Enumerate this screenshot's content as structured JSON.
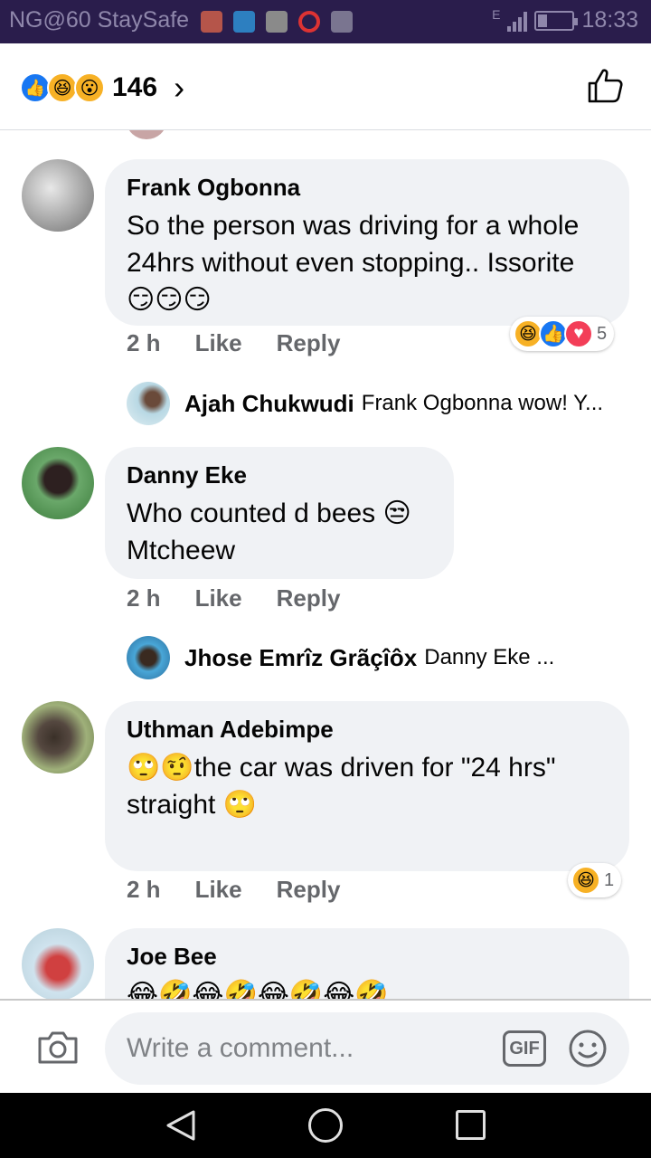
{
  "status_bar": {
    "carrier": "NG@60 StaySafe",
    "time": "18:33",
    "network": "E"
  },
  "header": {
    "reaction_icons": [
      "like-icon",
      "haha-icon",
      "wow-icon"
    ],
    "reaction_count": "146",
    "chevron": "›"
  },
  "comments": [
    {
      "name": "Frank Ogbonna",
      "text": "So the person was driving for a whole 24hrs without even stopping.. Issorite 😏😏😏",
      "time": "2 h",
      "like": "Like",
      "reply": "Reply",
      "reactions": [
        "haha-icon",
        "like-icon",
        "love-icon"
      ],
      "reaction_count": "5",
      "reply_preview": {
        "name": "Ajah Chukwudi",
        "text": "Frank Ogbonna wow! Y..."
      }
    },
    {
      "name": "Danny Eke",
      "text": "Who counted d bees 😒 Mtcheew",
      "time": "2 h",
      "like": "Like",
      "reply": "Reply",
      "reply_preview": {
        "name": "Jhose Emrîz Grãçîôx",
        "text": "Danny Eke ..."
      }
    },
    {
      "name": "Uthman Adebimpe",
      "text": "🙄🤨the car was driven for \"24 hrs\" straight 🙄",
      "time": "2 h",
      "like": "Like",
      "reply": "Reply",
      "reactions": [
        "haha-icon"
      ],
      "reaction_count": "1"
    },
    {
      "name": "Joe Bee",
      "text": "😂🤣😂🤣😂🤣😂🤣"
    }
  ],
  "composer": {
    "placeholder": "Write a comment...",
    "gif_label": "GIF"
  },
  "colors": {
    "status_bar_bg": "#2a1d4c",
    "bubble_bg": "#f0f2f5",
    "meta_text": "#65676b",
    "like_blue": "#1877f2",
    "love_red": "#f33e58",
    "haha_yellow": "#f7b125"
  }
}
